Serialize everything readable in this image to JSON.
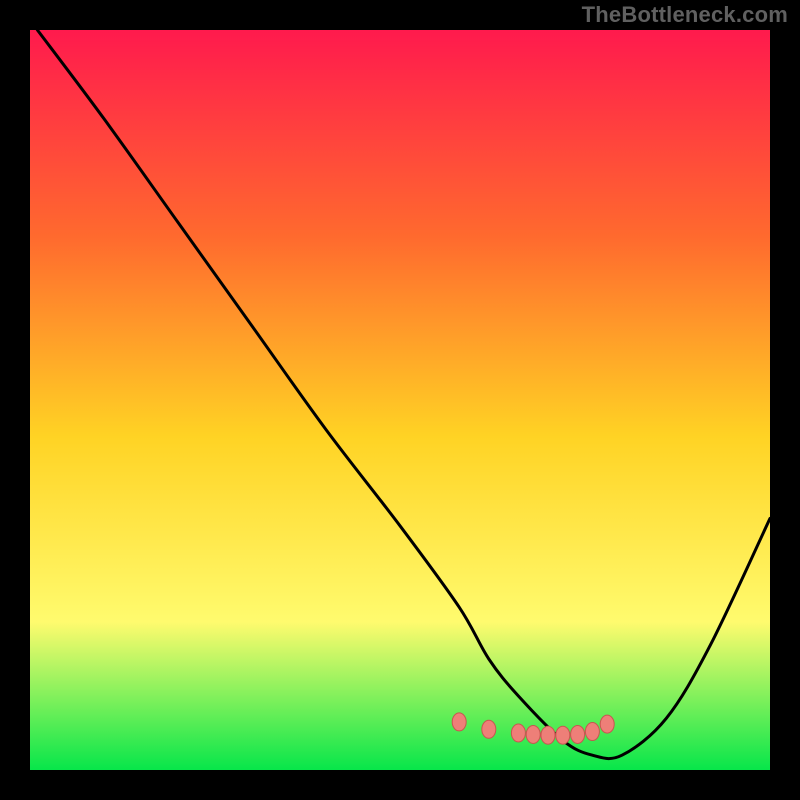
{
  "watermark": "TheBottleneck.com",
  "colors": {
    "page_bg": "#000000",
    "gradient_top": "#ff1a4d",
    "gradient_mid1": "#ff6a2e",
    "gradient_mid2": "#ffd324",
    "gradient_mid3": "#fffb6e",
    "gradient_bottom": "#07e64a",
    "curve": "#000000",
    "marker_fill": "#ee7f78",
    "marker_stroke": "#c75650"
  },
  "chart_data": {
    "type": "line",
    "title": "",
    "xlabel": "",
    "ylabel": "",
    "xlim": [
      0,
      100
    ],
    "ylim": [
      0,
      100
    ],
    "series": [
      {
        "name": "bottleneck-curve",
        "x": [
          1,
          10,
          20,
          30,
          40,
          50,
          58,
          62,
          66,
          72,
          76,
          80,
          86,
          92,
          100
        ],
        "values": [
          100,
          88,
          74,
          60,
          46,
          33,
          22,
          15,
          10,
          4,
          2,
          2,
          7,
          17,
          34
        ]
      }
    ],
    "markers": {
      "name": "highlight-band",
      "x": [
        58,
        62,
        66,
        68,
        70,
        72,
        74,
        76,
        78
      ],
      "values": [
        6.5,
        5.5,
        5.0,
        4.8,
        4.7,
        4.7,
        4.8,
        5.2,
        6.2
      ]
    }
  }
}
